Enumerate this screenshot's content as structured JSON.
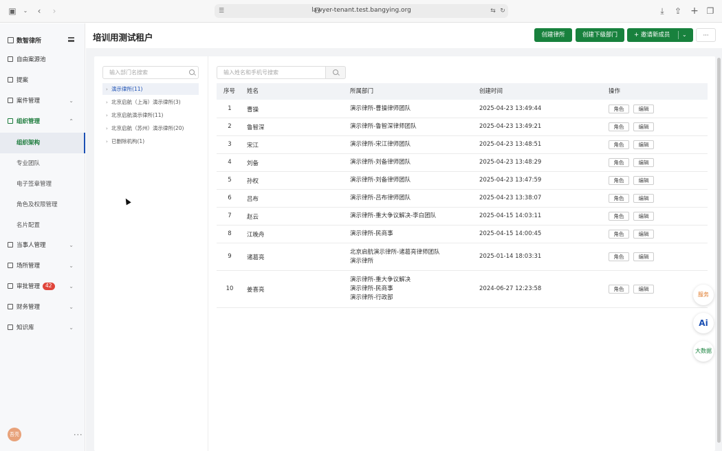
{
  "browser": {
    "url": "lawyer-tenant.test.bangying.org"
  },
  "sidebar": {
    "brand": "数智律所",
    "items": [
      {
        "label": "自由案源池"
      },
      {
        "label": "提案"
      },
      {
        "label": "案件管理"
      },
      {
        "label": "组织管理"
      },
      {
        "label": "当事人管理"
      },
      {
        "label": "场所管理"
      },
      {
        "label": "审批管理",
        "badge": "42"
      },
      {
        "label": "财务管理"
      },
      {
        "label": "知识库"
      }
    ],
    "sub_items": [
      {
        "label": "组织架构"
      },
      {
        "label": "专业团队"
      },
      {
        "label": "电子签章管理"
      },
      {
        "label": "角色及权限管理"
      },
      {
        "label": "名片配置"
      }
    ],
    "avatar_text": "吾亮"
  },
  "header": {
    "title": "培训用测试租户",
    "buttons": {
      "create_firm": "创建律所",
      "create_dept": "创建下级部门",
      "invite": "+ 邀请新成员"
    }
  },
  "tree": {
    "placeholder": "输入部门名搜索",
    "items": [
      {
        "label": "演示律所(11)"
      },
      {
        "label": "北京启航（上海）演示律所(3)"
      },
      {
        "label": "北京启航演示律所(11)"
      },
      {
        "label": "北京启航（苏州）演示律所(20)"
      },
      {
        "label": "已删除机构(1)"
      }
    ]
  },
  "member_search": {
    "placeholder": "输入姓名和手机号搜索"
  },
  "table": {
    "headers": {
      "idx": "序号",
      "name": "姓名",
      "dept": "所属部门",
      "created": "创建时间",
      "ops": "操作"
    },
    "role_label": "角色",
    "edit_label": "编辑",
    "rows": [
      {
        "idx": "1",
        "name": "曹操",
        "dept": [
          "演示律所-曹操律师团队"
        ],
        "created": "2025-04-23 13:49:44"
      },
      {
        "idx": "2",
        "name": "鲁智深",
        "dept": [
          "演示律所-鲁智深律师团队"
        ],
        "created": "2025-04-23 13:49:21"
      },
      {
        "idx": "3",
        "name": "宋江",
        "dept": [
          "演示律所-宋江律师团队"
        ],
        "created": "2025-04-23 13:48:51"
      },
      {
        "idx": "4",
        "name": "刘备",
        "dept": [
          "演示律所-刘备律师团队"
        ],
        "created": "2025-04-23 13:48:29"
      },
      {
        "idx": "5",
        "name": "孙权",
        "dept": [
          "演示律所-刘备律师团队"
        ],
        "created": "2025-04-23 13:47:59"
      },
      {
        "idx": "6",
        "name": "吕布",
        "dept": [
          "演示律所-吕布律师团队"
        ],
        "created": "2025-04-23 13:38:07"
      },
      {
        "idx": "7",
        "name": "赵云",
        "dept": [
          "演示律所-重大争议解决-李白团队"
        ],
        "created": "2025-04-15 14:03:11"
      },
      {
        "idx": "8",
        "name": "江晚舟",
        "dept": [
          "演示律所-民商事"
        ],
        "created": "2025-04-15 14:00:45"
      },
      {
        "idx": "9",
        "name": "诸葛亮",
        "dept": [
          "北京启航演示律所-诸葛亮律师团队",
          "演示律所"
        ],
        "created": "2025-01-14 18:03:31"
      },
      {
        "idx": "10",
        "name": "姜喜亮",
        "dept": [
          "演示律所-重大争议解决",
          "演示律所-民商事",
          "演示律所-行政部"
        ],
        "created": "2024-06-27 12:23:58"
      }
    ]
  },
  "floating": {
    "service": "服务",
    "ai": "Ai",
    "bigdata": "大数据"
  },
  "colors": {
    "primary_green": "#18813d",
    "active_blue": "#1a4fb3",
    "badge_red": "#e0453a"
  }
}
